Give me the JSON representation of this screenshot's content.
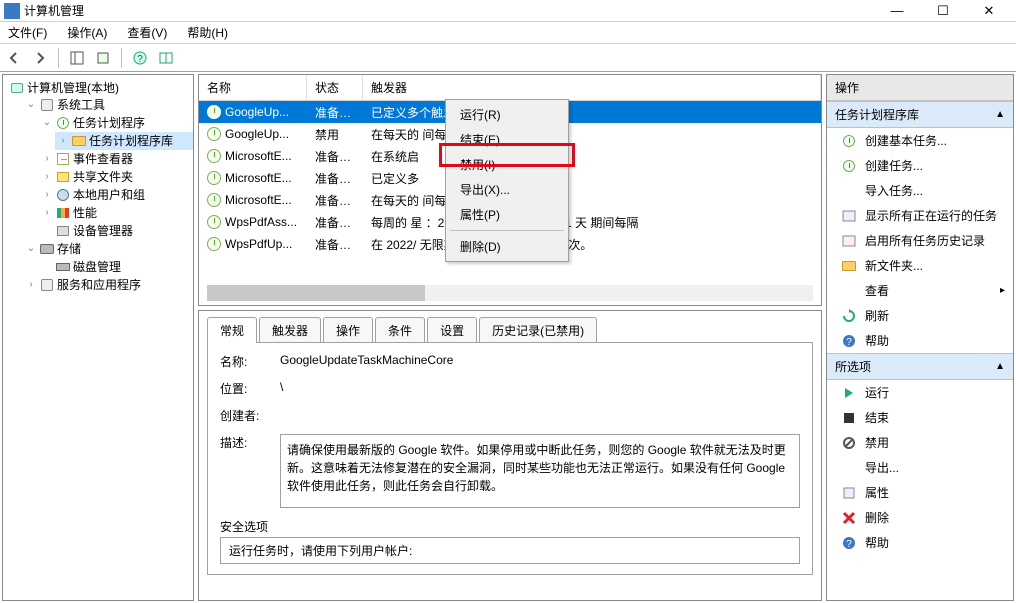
{
  "title": "计算机管理",
  "win_buttons": {
    "min": "—",
    "max": "☐",
    "close": "✕"
  },
  "menu": [
    "文件(F)",
    "操作(A)",
    "查看(V)",
    "帮助(H)"
  ],
  "tree": {
    "root": "计算机管理(本地)",
    "system_tools": "系统工具",
    "scheduler": "任务计划程序",
    "scheduler_lib": "任务计划程序库",
    "event_viewer": "事件查看器",
    "shared": "共享文件夹",
    "users": "本地用户和组",
    "perf": "性能",
    "devmgr": "设备管理器",
    "storage": "存储",
    "diskm": "磁盘管理",
    "services": "服务和应用程序"
  },
  "list": {
    "headers": {
      "name": "名称",
      "status": "状态",
      "trigger": "触发器"
    },
    "rows": [
      {
        "name": "GoogleUp...",
        "status": "准备就绪",
        "trigger": "已定义多个触发器"
      },
      {
        "name": "GoogleUp...",
        "status": "禁用",
        "trigger": "在每天的                                               间每隔 1 小时 重复一次。"
      },
      {
        "name": "MicrosoftE...",
        "status": "准备就绪",
        "trigger": "在系统启"
      },
      {
        "name": "MicrosoftE...",
        "status": "准备就绪",
        "trigger": "已定义多"
      },
      {
        "name": "MicrosoftE...",
        "status": "准备就绪",
        "trigger": "在每天的                                               间每隔 1 小时 重复一次。"
      },
      {
        "name": "WpsPdfAss...",
        "status": "准备就绪",
        "trigger": "每周的 星                                               ：2022/3/21 - 触发后，在 1 天 期间每隔"
      },
      {
        "name": "WpsPdfUp...",
        "status": "准备就绪",
        "trigger": "在 2022/                                               无限期地每隔 1 小时 重复一次。"
      }
    ]
  },
  "ctx": {
    "run": "运行(R)",
    "end": "结束(E)",
    "disable": "禁用(I)",
    "export": "导出(X)...",
    "props": "属性(P)",
    "delete": "删除(D)"
  },
  "detail": {
    "tabs": [
      "常规",
      "触发器",
      "操作",
      "条件",
      "设置",
      "历史记录(已禁用)"
    ],
    "name_lbl": "名称:",
    "name_val": "GoogleUpdateTaskMachineCore",
    "loc_lbl": "位置:",
    "loc_val": "\\",
    "creator_lbl": "创建者:",
    "creator_val": "",
    "desc_lbl": "描述:",
    "desc_val": "请确保使用最新版的 Google 软件。如果停用或中断此任务，则您的 Google 软件就无法及时更新。这意味着无法修复潜在的安全漏洞，同时某些功能也无法正常运行。如果没有任何 Google 软件使用此任务，则此任务会自行卸载。",
    "sec_title": "安全选项",
    "sec_line": "运行任务时，请使用下列用户帐户:"
  },
  "actions": {
    "hdr": "操作",
    "sec1": "任务计划程序库",
    "create_basic": "创建基本任务...",
    "create_task": "创建任务...",
    "import": "导入任务...",
    "show_running": "显示所有正在运行的任务",
    "enable_hist": "启用所有任务历史记录",
    "new_folder": "新文件夹...",
    "view": "查看",
    "refresh": "刷新",
    "help": "帮助",
    "sec2": "所选项",
    "run": "运行",
    "end": "结束",
    "disable": "禁用",
    "export": "导出...",
    "props": "属性",
    "delete": "删除",
    "help2": "帮助"
  }
}
